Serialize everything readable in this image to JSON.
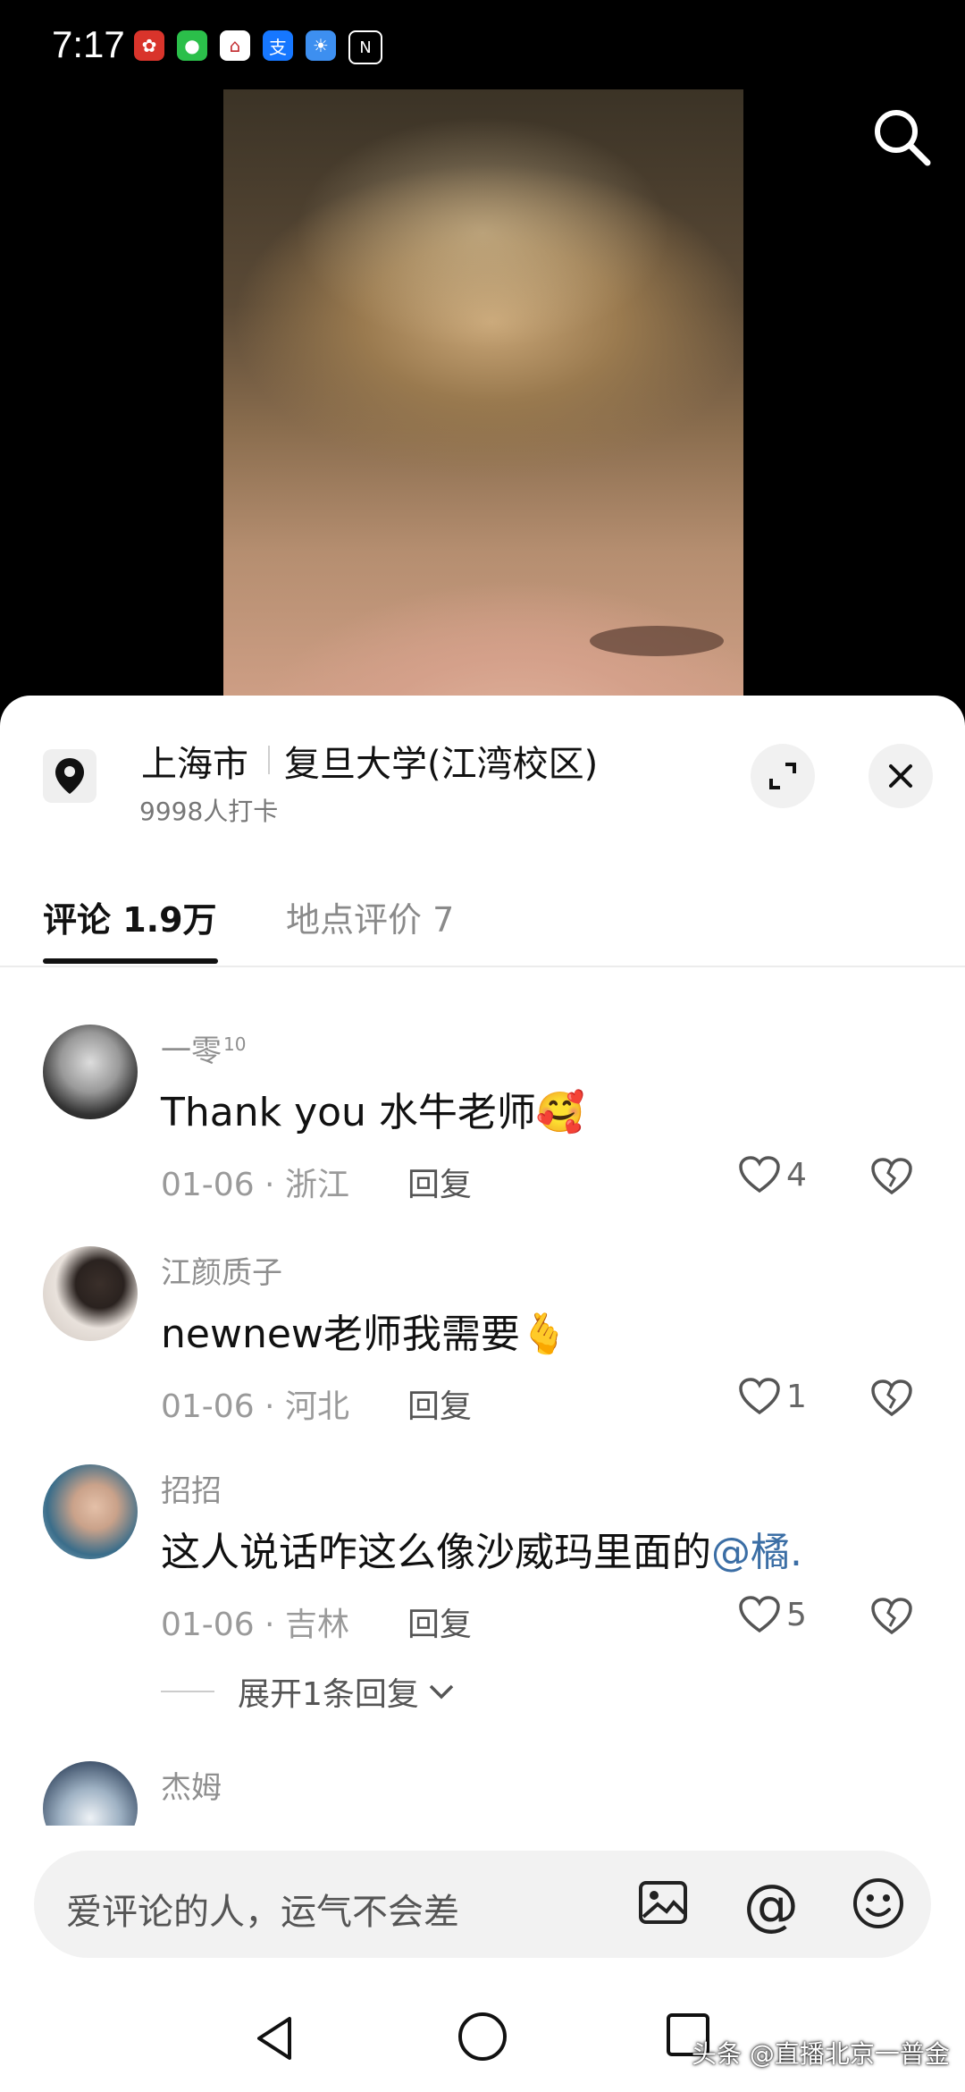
{
  "status_bar": {
    "time": "7:17",
    "icons": [
      "huawei-app-icon",
      "wechat-icon",
      "bank-app-icon",
      "alipay-icon",
      "weather-icon",
      "nfc-icon"
    ]
  },
  "location": {
    "city": "上海市",
    "place": "复旦大学(江湾校区)",
    "checkins": "9998人打卡"
  },
  "tabs": {
    "comments": "评论 1.9万",
    "reviews": "地点评价 7"
  },
  "comments": [
    {
      "user": "一零",
      "badge": "10",
      "text": "Thank you 水牛老师",
      "emoji": "🥰",
      "date_loc": "01-06 · 浙江",
      "reply": "回复",
      "likes": "4"
    },
    {
      "user": "江颜质子",
      "badge": "",
      "text": "newnew老师我需要",
      "emoji": "🫰",
      "date_loc": "01-06 · 河北",
      "reply": "回复",
      "likes": "1"
    },
    {
      "user": "招招",
      "badge": "",
      "text": "这人说话咋这么像沙威玛里面的",
      "mention": "@橘.",
      "date_loc": "01-06 · 吉林",
      "reply": "回复",
      "likes": "5",
      "expand": "展开1条回复"
    },
    {
      "user": "杰姆"
    }
  ],
  "input": {
    "placeholder": "爱评论的人，运气不会差",
    "at_symbol": "@"
  },
  "watermark": "头条 @直播北京一普金",
  "colors": {
    "mention": "#3b6ea5",
    "sheet_bg": "#ffffff",
    "input_bg": "#f2f2f2"
  }
}
